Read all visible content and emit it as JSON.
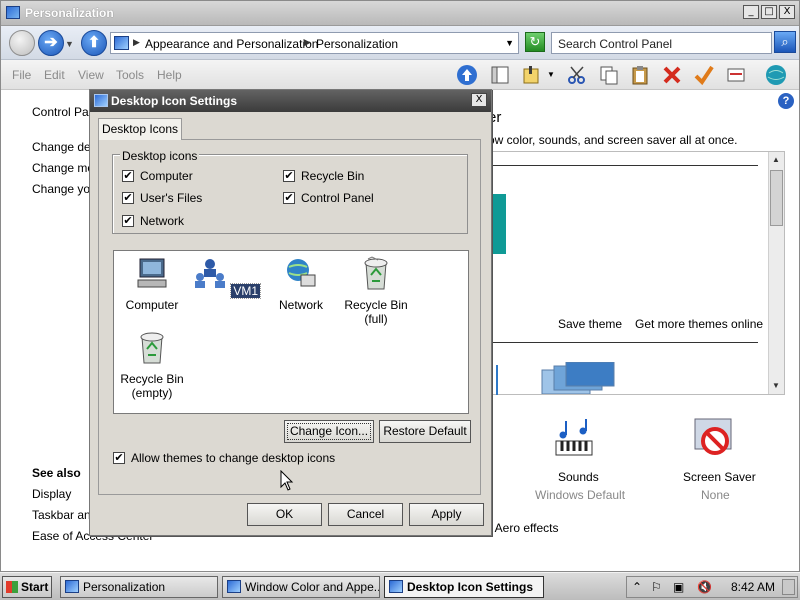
{
  "window": {
    "title": "Personalization",
    "min": "_",
    "max": "□",
    "close": "X"
  },
  "nav": {
    "crumbs": [
      "Appearance and Personalization",
      "Personalization"
    ],
    "search_placeholder": "Search Control Panel"
  },
  "menu": [
    "File",
    "Edit",
    "View",
    "Tools",
    "Help"
  ],
  "page": {
    "left_links_top": [
      "Control Pan",
      "Change des",
      "Change mou",
      "Change you"
    ],
    "header_right": "er",
    "description": "ow color, sounds, and screen saver all at once.",
    "save_theme": "Save theme",
    "get_more_themes": "Get more themes online",
    "see_also_heading": "See also",
    "see_also_links": [
      "Display",
      "Taskbar and",
      "Ease of Access Center"
    ],
    "aero_effects": "r Aero effects",
    "sounds_label": "Sounds",
    "sounds_value": "Windows Default",
    "saver_label": "Screen Saver",
    "saver_value": "None"
  },
  "dialog": {
    "title": "Desktop Icon Settings",
    "close": "X",
    "tab": "Desktop Icons",
    "group_label": "Desktop icons",
    "checkboxes": [
      {
        "label": "Computer",
        "checked": true
      },
      {
        "label": "Recycle Bin",
        "checked": true
      },
      {
        "label": "User's Files",
        "checked": true
      },
      {
        "label": "Control Panel",
        "checked": true
      },
      {
        "label": "Network",
        "checked": true
      }
    ],
    "icons": [
      {
        "label": "Computer",
        "selected": false
      },
      {
        "label": "VM1",
        "selected": true
      },
      {
        "label": "Network",
        "selected": false
      },
      {
        "label": "Recycle Bin (full)",
        "selected": false
      },
      {
        "label": "Recycle Bin (empty)",
        "selected": false
      }
    ],
    "change_icon": "Change Icon...",
    "restore_default": "Restore Default",
    "allow_themes": "Allow themes to change desktop icons",
    "allow_themes_checked": true,
    "ok": "OK",
    "cancel": "Cancel",
    "apply": "Apply",
    "check_mark": "✔"
  },
  "taskbar": {
    "start": "Start",
    "tasks": [
      {
        "label": "Personalization",
        "active": false
      },
      {
        "label": "Window Color and Appe...",
        "active": false
      },
      {
        "label": "Desktop Icon Settings",
        "active": true
      }
    ],
    "clock": "8:42 AM"
  }
}
